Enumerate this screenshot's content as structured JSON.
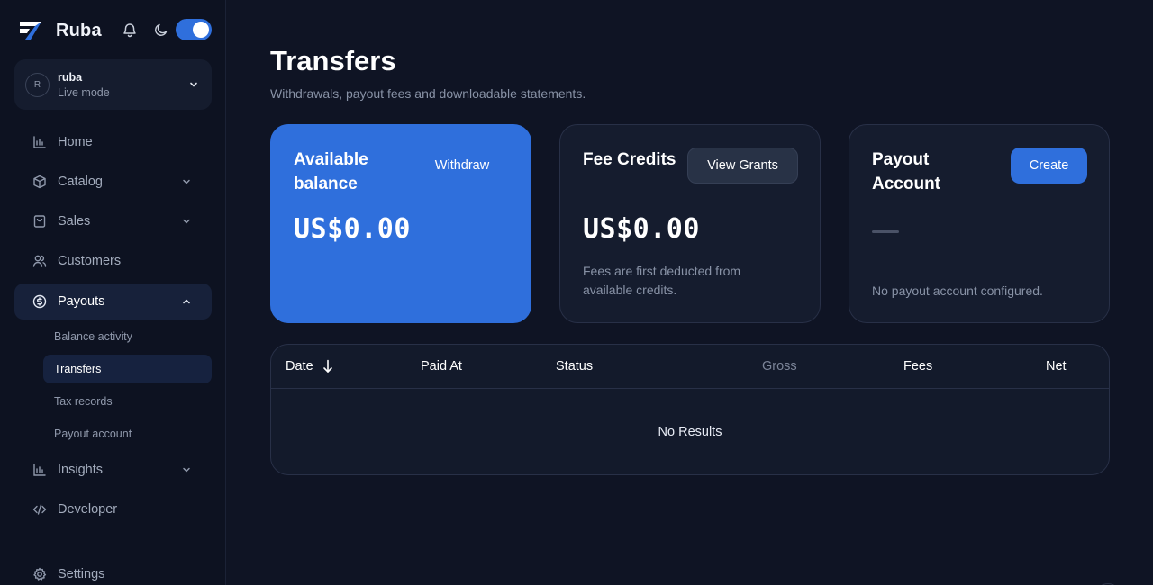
{
  "app": {
    "name": "Ruba",
    "theme_toggle": "on"
  },
  "account": {
    "avatar_initial": "R",
    "name": "ruba",
    "mode": "Live mode"
  },
  "nav": {
    "home": "Home",
    "catalog": "Catalog",
    "sales": "Sales",
    "customers": "Customers",
    "payouts": "Payouts",
    "payouts_sub": {
      "balance_activity": "Balance activity",
      "transfers": "Transfers",
      "tax_records": "Tax records",
      "payout_account": "Payout account"
    },
    "insights": "Insights",
    "developer": "Developer",
    "settings": "Settings"
  },
  "page": {
    "title": "Transfers",
    "subtitle": "Withdrawals, payout fees and downloadable statements."
  },
  "cards": {
    "available": {
      "title": "Available balance",
      "action": "Withdraw",
      "amount": "US$0.00"
    },
    "fee_credits": {
      "title": "Fee Credits",
      "action": "View Grants",
      "amount": "US$0.00",
      "note": "Fees are first deducted from available credits."
    },
    "payout_account": {
      "title": "Payout Account",
      "action": "Create",
      "note": "No payout account configured."
    }
  },
  "table": {
    "columns": {
      "date": "Date",
      "paid_at": "Paid At",
      "status": "Status",
      "gross": "Gross",
      "fees": "Fees",
      "net": "Net"
    },
    "sort": {
      "column": "Date",
      "direction": "descending"
    },
    "empty": "No Results"
  },
  "colors": {
    "accent": "#2f6fdc",
    "background": "#0f1424",
    "sidebar": "#0d1221",
    "card": "#151c2e"
  }
}
